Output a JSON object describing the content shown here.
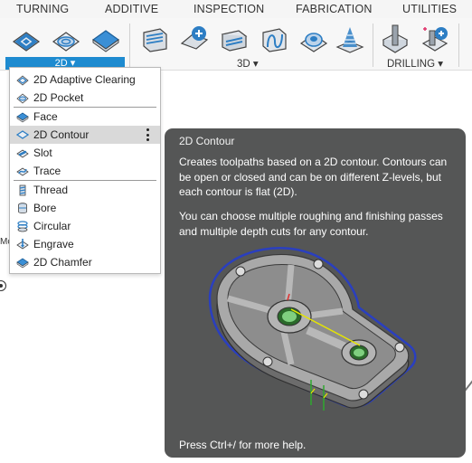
{
  "ribbon": {
    "tabs": [
      "TURNING",
      "ADDITIVE",
      "INSPECTION",
      "FABRICATION",
      "UTILITIES"
    ]
  },
  "toolbar": {
    "groups": {
      "twod": "2D ▾",
      "threed": "3D ▾",
      "drilling": "DRILLING ▾"
    }
  },
  "menu": {
    "items": [
      {
        "label": "2D Adaptive Clearing",
        "icon": "adaptive-clearing-icon"
      },
      {
        "label": "2D Pocket",
        "icon": "pocket-icon"
      },
      {
        "label": "Face",
        "icon": "face-icon"
      },
      {
        "label": "2D Contour",
        "icon": "contour-icon",
        "active": true
      },
      {
        "label": "Slot",
        "icon": "slot-icon"
      },
      {
        "label": "Trace",
        "icon": "trace-icon"
      },
      {
        "label": "Thread",
        "icon": "thread-icon"
      },
      {
        "label": "Bore",
        "icon": "bore-icon"
      },
      {
        "label": "Circular",
        "icon": "circular-icon"
      },
      {
        "label": "Engrave",
        "icon": "engrave-icon"
      },
      {
        "label": "2D Chamfer",
        "icon": "chamfer-icon"
      }
    ]
  },
  "tooltip": {
    "title": "2D Contour",
    "p1": "Creates toolpaths based on a 2D contour. Contours can be open or closed and can be on different Z-levels, but each contour is flat (2D).",
    "p2": "You can choose multiple roughing and finishing passes and multiple depth cuts for any contour.",
    "footer": "Press Ctrl+/ for more help."
  },
  "background": {
    "fragment_text": "Mc"
  },
  "colors": {
    "accent": "#1e8bd0",
    "tooltip_bg": "#555656",
    "icon_blue": "#2d7ec4"
  }
}
